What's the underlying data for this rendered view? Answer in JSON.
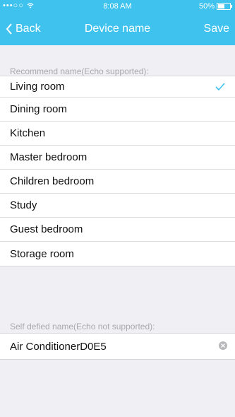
{
  "status_bar": {
    "signal": "•••○○",
    "wifi_icon": "wifi-icon",
    "time": "8:08 AM",
    "battery_label": "50%"
  },
  "nav": {
    "back_label": "Back",
    "title": "Device name",
    "save_label": "Save"
  },
  "recommend": {
    "label": "Recommend name(Echo supported):",
    "items": [
      {
        "label": "Living room"
      },
      {
        "label": "Dining room"
      },
      {
        "label": "Kitchen"
      },
      {
        "label": "Master bedroom"
      },
      {
        "label": "Children bedroom"
      },
      {
        "label": "Study"
      },
      {
        "label": "Guest bedroom"
      },
      {
        "label": "Storage room"
      }
    ],
    "selected_index": 0
  },
  "custom": {
    "label": "Self defied name(Echo not supported):",
    "value": "Air ConditionerD0E5"
  },
  "colors": {
    "accent": "#3fc3ee",
    "background": "#efeff4"
  }
}
